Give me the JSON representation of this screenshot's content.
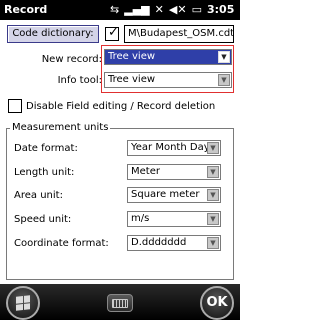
{
  "titlebar": {
    "title": "Record",
    "time": "3:05",
    "icons": [
      "sync-icon",
      "signal-icon",
      "no-signal-icon",
      "volume-mute-icon",
      "battery-icon"
    ]
  },
  "code_dictionary": {
    "button_label": "Code dictionary:",
    "checked": true,
    "path": "M\\Budapest_OSM.cdt"
  },
  "new_record": {
    "label": "New record:",
    "value": "Tree view"
  },
  "info_tool": {
    "label": "Info tool:",
    "value": "Tree view"
  },
  "disable_editing": {
    "label": "Disable Field editing / Record deletion",
    "checked": false
  },
  "measurement_units": {
    "title": "Measurement units",
    "rows": [
      {
        "label": "Date format:",
        "value": "Year Month Day"
      },
      {
        "label": "Length unit:",
        "value": "Meter"
      },
      {
        "label": "Area unit:",
        "value": "Square meter"
      },
      {
        "label": "Speed unit:",
        "value": "m/s"
      },
      {
        "label": "Coordinate format:",
        "value": "D.ddddddd"
      }
    ]
  },
  "bottombar": {
    "ok_label": "OK"
  },
  "colors": {
    "selection": "#2f3fa8",
    "highlight": "#e03030",
    "titlebar": "#000000"
  }
}
